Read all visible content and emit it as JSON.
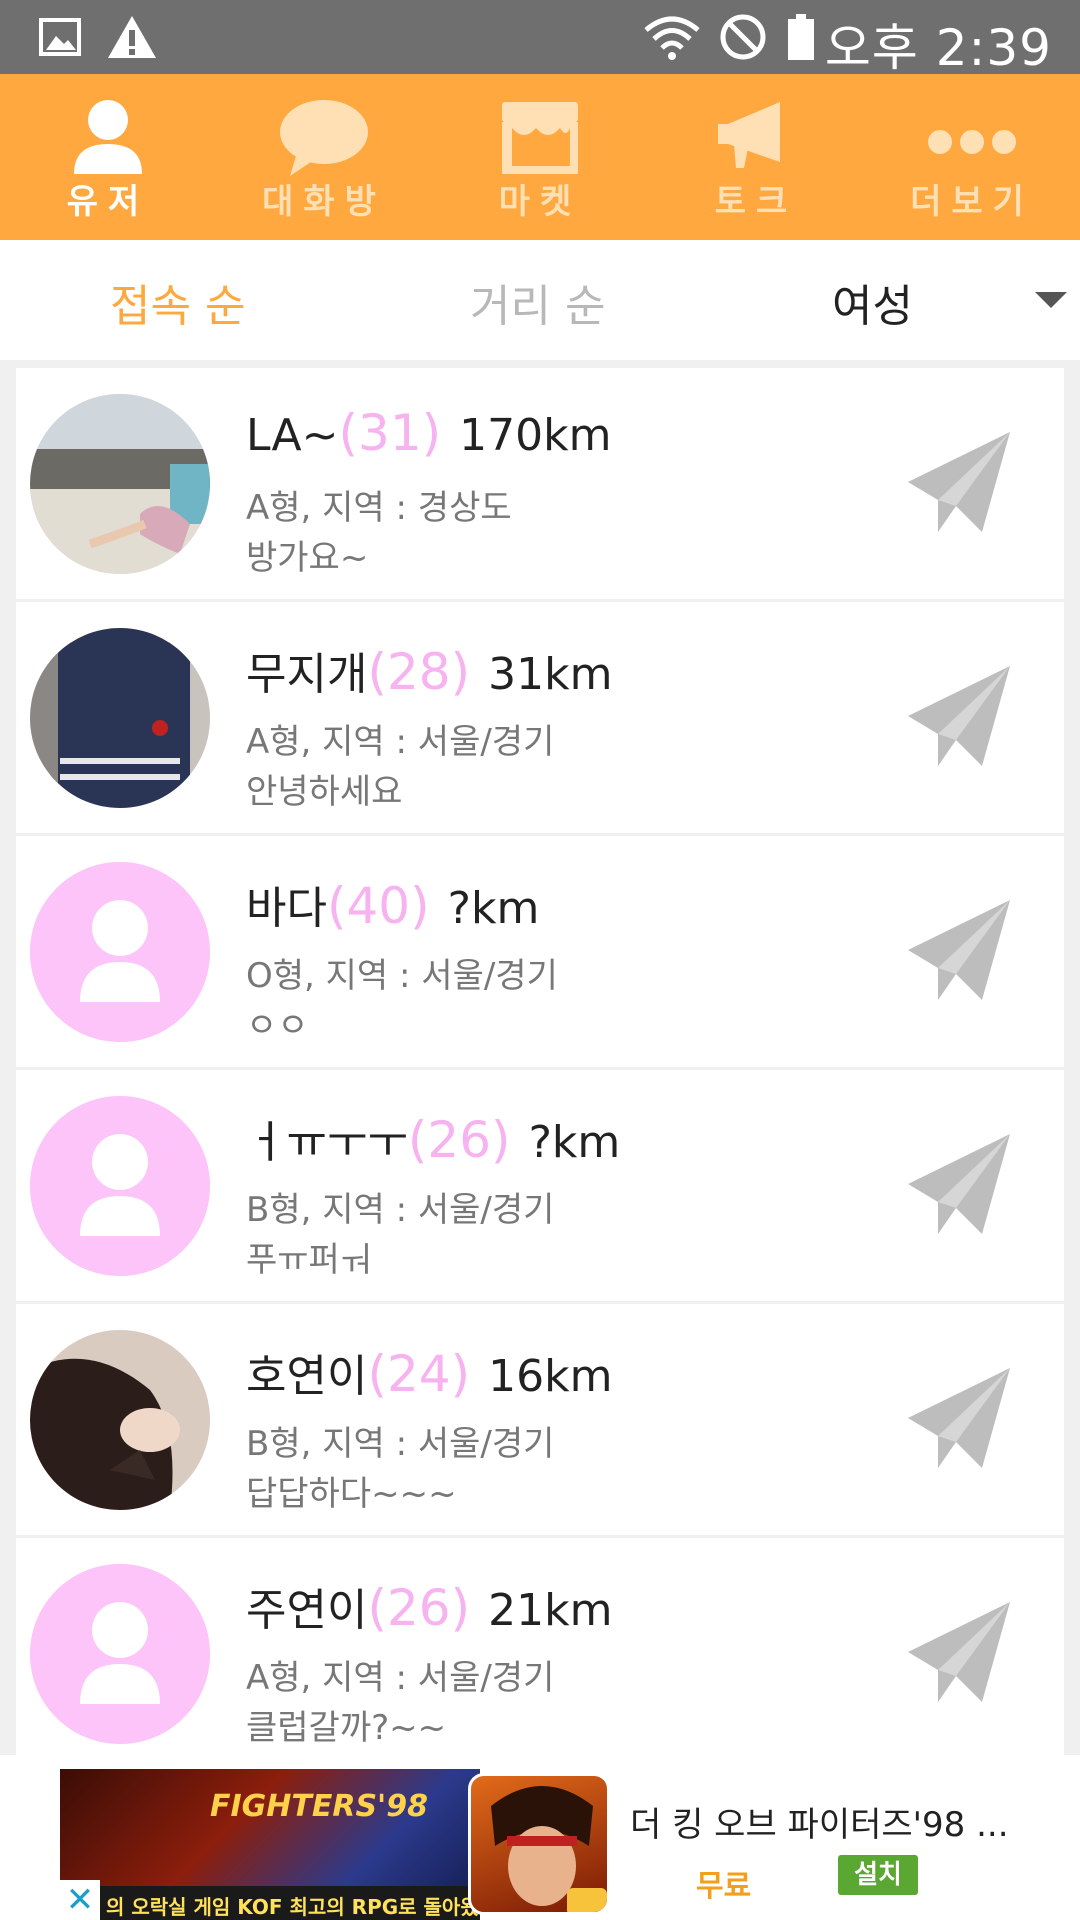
{
  "status_bar": {
    "time": "오후 2:39",
    "icons": [
      "image-icon",
      "warning-icon",
      "wifi-icon",
      "do-not-disturb-icon",
      "battery-icon"
    ]
  },
  "nav": {
    "tabs": [
      {
        "label": "유저",
        "icon": "person-icon",
        "active": true
      },
      {
        "label": "대화방",
        "icon": "chat-bubble-icon",
        "active": false
      },
      {
        "label": "마켓",
        "icon": "store-icon",
        "active": false
      },
      {
        "label": "토크",
        "icon": "megaphone-icon",
        "active": false
      },
      {
        "label": "더보기",
        "icon": "more-dots-icon",
        "active": false
      }
    ],
    "accent_color": "#fea83f"
  },
  "filter": {
    "sort_by_connection": "접속 순",
    "sort_by_distance": "거리 순",
    "gender": "여성"
  },
  "users": [
    {
      "name": "LA~",
      "age": "(31)",
      "distance": "170km",
      "info": "A형,  지역 : 경상도",
      "message": "방가요~",
      "avatar": "photo-beach"
    },
    {
      "name": "무지개",
      "age": "(28)",
      "distance": "31km",
      "info": "A형,  지역 : 서울/경기",
      "message": "안녕하세요",
      "avatar": "photo-dress"
    },
    {
      "name": "바다",
      "age": "(40)",
      "distance": "?km",
      "info": "O형,  지역 : 서울/경기",
      "message": "ㅇㅇ",
      "avatar": "default"
    },
    {
      "name": "ㅓㅠㅜㅜ",
      "age": "(26)",
      "distance": "?km",
      "info": "B형,  지역 : 서울/경기",
      "message": "푸ㅠ퍼ㅝ",
      "avatar": "default"
    },
    {
      "name": "호연이",
      "age": "(24)",
      "distance": "16km",
      "info": "B형,  지역 : 서울/경기",
      "message": "답답하다~~~",
      "avatar": "photo-hair"
    },
    {
      "name": "주연이",
      "age": "(26)",
      "distance": "21km",
      "info": "A형,  지역 : 서울/경기",
      "message": "클럽갈까?~~",
      "avatar": "default"
    }
  ],
  "ad": {
    "image_logo": "FIGHTERS'98",
    "image_caption": "의 오락실 게임 KOF 최고의 RPG로 돌아왔다",
    "title": "더 킹 오브 파이터즈'98 ...",
    "price": "무료",
    "install_label": "설치",
    "close_label": "✕"
  }
}
